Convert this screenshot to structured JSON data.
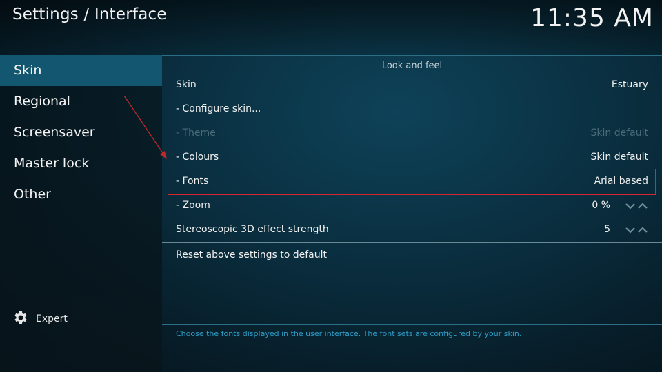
{
  "header": {
    "title": "Settings / Interface",
    "clock": "11:35 AM"
  },
  "sidebar": {
    "items": [
      {
        "label": "Skin",
        "active": true
      },
      {
        "label": "Regional"
      },
      {
        "label": "Screensaver"
      },
      {
        "label": "Master lock"
      },
      {
        "label": "Other"
      }
    ],
    "expert_label": "Expert"
  },
  "main": {
    "section_title": "Look and feel",
    "settings": [
      {
        "label": "Skin",
        "value": "Estuary"
      },
      {
        "label": "- Configure skin...",
        "value": ""
      },
      {
        "label": "- Theme",
        "value": "Skin default",
        "disabled": true
      },
      {
        "label": "- Colours",
        "value": "Skin default"
      },
      {
        "label": "- Fonts",
        "value": "Arial based",
        "highlighted": true
      },
      {
        "label": "- Zoom",
        "value": "0 %",
        "spinner": true
      },
      {
        "label": "Stereoscopic 3D effect strength",
        "value": "5",
        "spinner": true
      }
    ],
    "reset_label": "Reset above settings to default",
    "hint": "Choose the fonts displayed in the user interface. The font sets are configured by your skin."
  },
  "colors": {
    "accent": "#12566f",
    "highlight_border": "#d9252d",
    "annotation_arrow": "#c0282c",
    "hint_text": "#2f9fc9",
    "disabled_text": "#4a6c79"
  },
  "icons": {
    "expert": "gear-icon",
    "spinner_down": "chevron-down-icon",
    "spinner_up": "chevron-up-icon"
  }
}
